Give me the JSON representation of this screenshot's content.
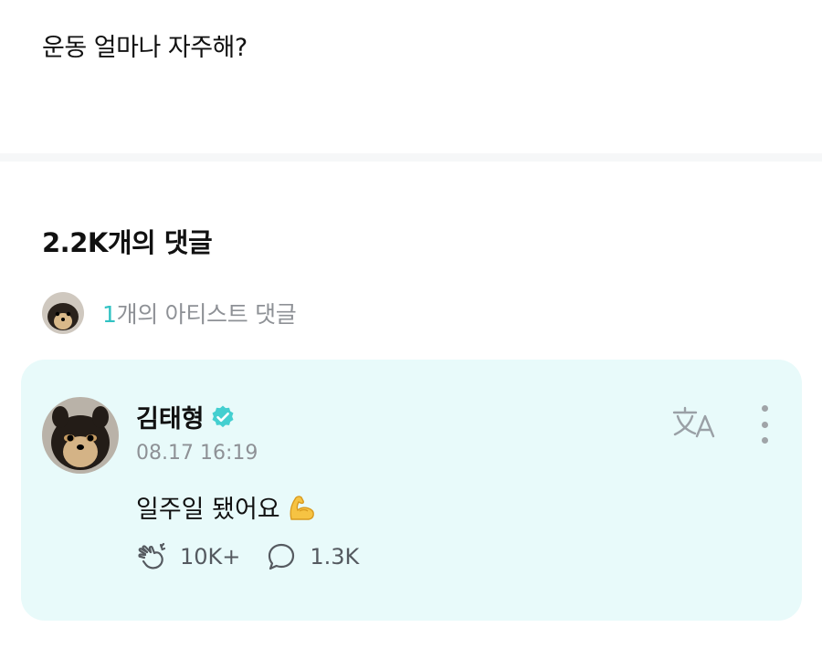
{
  "post": {
    "text": "운동 얼마나 자주해?"
  },
  "comments": {
    "count_label": "2.2K개의 댓글",
    "artist_comments": {
      "count": "1",
      "label": "개의 아티스트 댓글"
    }
  },
  "comment": {
    "author": "김태형",
    "timestamp": "08.17 16:19",
    "text": "일주일 됐어요",
    "likes": "10K+",
    "replies": "1.3K"
  },
  "colors": {
    "accent": "#31c2c3",
    "card_bg": "#e8fafa",
    "muted": "#8e9196"
  }
}
